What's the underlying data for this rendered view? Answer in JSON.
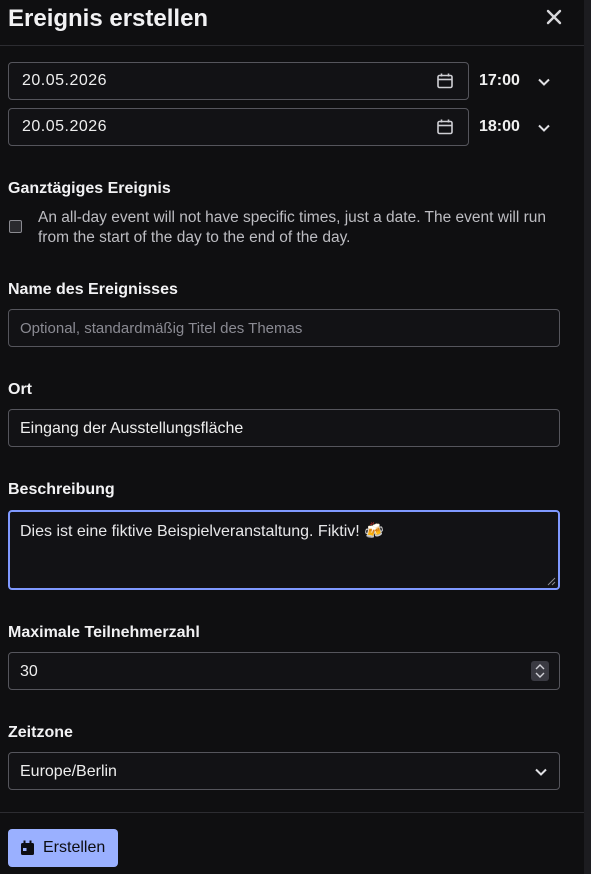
{
  "dialog": {
    "title": "Ereignis erstellen"
  },
  "start": {
    "date": "20.05.2026",
    "time": "17:00"
  },
  "end": {
    "date": "20.05.2026",
    "time": "18:00"
  },
  "all_day": {
    "label": "Ganztägiges Ereignis",
    "checked": false,
    "help": "An all-day event will not have specific times, just a date. The event will run from the start of the day to the end of the day."
  },
  "event_name": {
    "label": "Name des Ereignisses",
    "value": "",
    "placeholder": "Optional, standardmäßig Titel des Themas"
  },
  "location": {
    "label": "Ort",
    "value": "Eingang der Ausstellungsfläche"
  },
  "description": {
    "label": "Beschreibung",
    "value": "Dies ist eine fiktive Beispielveranstaltung. Fiktiv! 🍻"
  },
  "max_attendees": {
    "label": "Maximale Teilnehmerzahl",
    "value": "30"
  },
  "timezone": {
    "label": "Zeitzone",
    "value": "Europe/Berlin"
  },
  "footer": {
    "create_label": "Erstellen"
  },
  "colors": {
    "accent": "#9ab0ff",
    "focus_border": "#7f99ff",
    "background": "#0f0f11"
  }
}
